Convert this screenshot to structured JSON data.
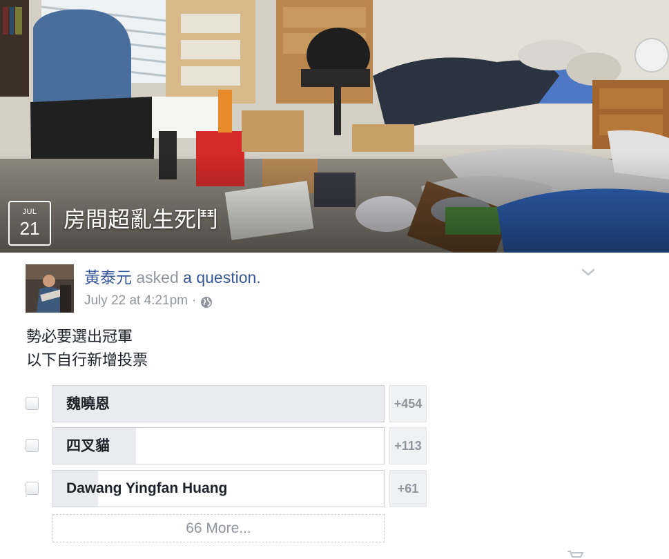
{
  "event": {
    "date_month": "JUL",
    "date_day": "21",
    "title": "房間超亂生死鬥"
  },
  "post": {
    "author": "黃泰元",
    "action": "asked",
    "action_link": "a question",
    "timestamp": "July 22 at 4:21pm",
    "privacy_icon": "globe-icon",
    "menu_icon": "chevron-down-icon",
    "body_lines": [
      "勢必要選出冠軍",
      "以下自行新增投票"
    ]
  },
  "poll": {
    "options": [
      {
        "label": "魏曉恩",
        "count": "+454",
        "fill_fraction": 1.0
      },
      {
        "label": "四叉貓",
        "count": "+113",
        "fill_fraction": 0.25
      },
      {
        "label": "Dawang Yingfan Huang",
        "count": "+61",
        "fill_fraction": 0.135
      }
    ],
    "more_label": "66 More..."
  },
  "colors": {
    "link": "#365899",
    "muted": "#90949c",
    "poll_fill": "#e9ebee"
  }
}
